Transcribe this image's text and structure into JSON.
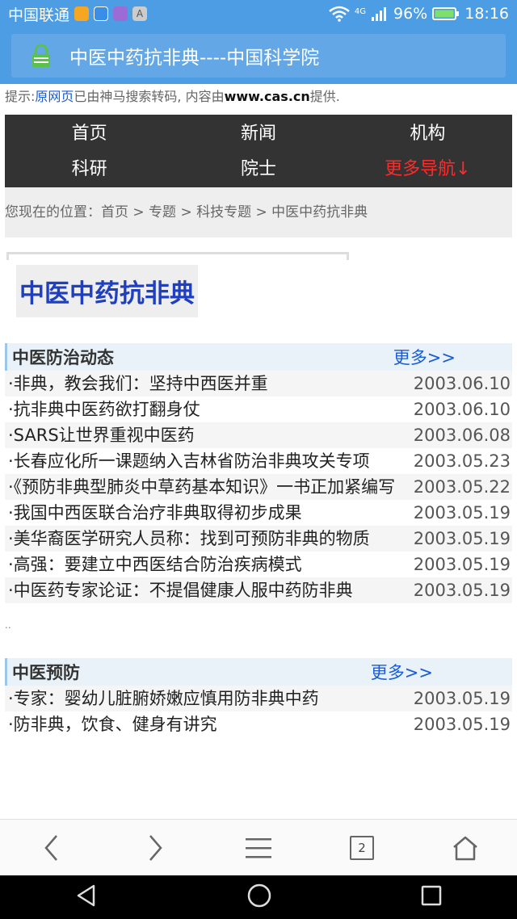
{
  "status_bar": {
    "carrier": "中国联通",
    "network": "4G",
    "battery": "96%",
    "time": "18:16"
  },
  "address_bar": {
    "title": "中医中药抗非典----中国科学院"
  },
  "tip": {
    "prefix": "提示:",
    "link": "原网页",
    "middle": "已由神马搜索转码, 内容由",
    "domain": "www.cas.cn",
    "suffix": "提供."
  },
  "nav": {
    "items": [
      "首页",
      "新闻",
      "机构",
      "科研",
      "院士",
      "更多导航↓"
    ]
  },
  "breadcrumb": {
    "text": "您现在的位置：首页 > 专题 > 科技专题 > 中医中药抗非典"
  },
  "page_title": "中医中药抗非典",
  "sections": [
    {
      "title": "中医防治动态",
      "more": "更多>>",
      "rows": [
        {
          "title": "·非典，教会我们：坚持中西医并重",
          "date": "2003.06.10"
        },
        {
          "title": "·抗非典中医药欲打翻身仗",
          "date": "2003.06.10"
        },
        {
          "title": "·SARS让世界重视中医药",
          "date": "2003.06.08"
        },
        {
          "title": "·长春应化所一课题纳入吉林省防治非典攻关专项",
          "date": "2003.05.23"
        },
        {
          "title": "·《预防非典型肺炎中草药基本知识》一书正加紧编写",
          "date": "2003.05.22"
        },
        {
          "title": "·我国中西医联合治疗非典取得初步成果",
          "date": "2003.05.19"
        },
        {
          "title": "·美华裔医学研究人员称：找到可预防非典的物质",
          "date": "2003.05.19"
        },
        {
          "title": "·高强：要建立中西医结合防治疾病模式",
          "date": "2003.05.19"
        },
        {
          "title": "·中医药专家论证：不提倡健康人服中药防非典",
          "date": "2003.05.19"
        }
      ]
    },
    {
      "title": "中医预防",
      "more": "更多>>",
      "rows": [
        {
          "title": "·专家：婴幼儿脏腑娇嫩应慎用防非典中药",
          "date": "2003.05.19"
        },
        {
          "title": "·防非典，饮食、健身有讲究",
          "date": "2003.05.19"
        }
      ]
    }
  ],
  "separator": "..",
  "browser_toolbar": {
    "tab_count": "2"
  },
  "colors": {
    "accent": "#4c9de3",
    "nav_bg": "#333333",
    "link": "#1a5bd6",
    "highlight": "#ff2a2a",
    "page_title": "#1f3fbf"
  }
}
